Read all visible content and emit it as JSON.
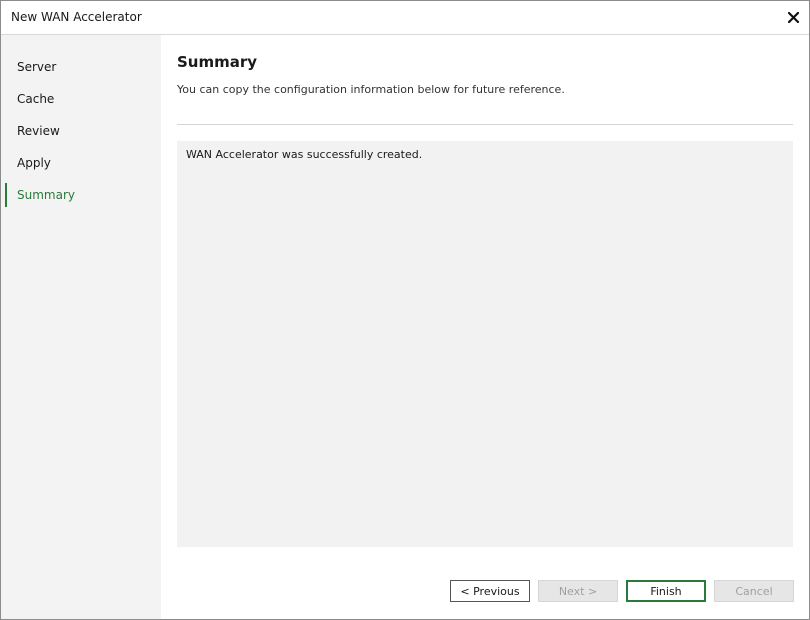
{
  "window": {
    "title": "New WAN Accelerator",
    "close_icon": "close-icon"
  },
  "sidebar": {
    "items": [
      {
        "label": "Server",
        "active": false
      },
      {
        "label": "Cache",
        "active": false
      },
      {
        "label": "Review",
        "active": false
      },
      {
        "label": "Apply",
        "active": false
      },
      {
        "label": "Summary",
        "active": true
      }
    ]
  },
  "main": {
    "title": "Summary",
    "subtitle": "You can copy the configuration information below for future reference.",
    "summary_text": "WAN Accelerator was successfully created."
  },
  "buttons": {
    "previous": {
      "label": "< Previous",
      "enabled": true
    },
    "next": {
      "label": "Next >",
      "enabled": false
    },
    "finish": {
      "label": "Finish",
      "enabled": true
    },
    "cancel": {
      "label": "Cancel",
      "enabled": false
    }
  },
  "colors": {
    "accent": "#2a7a3b",
    "sidebar_bg": "#f3f3f3",
    "summary_bg": "#f1f2f1"
  }
}
